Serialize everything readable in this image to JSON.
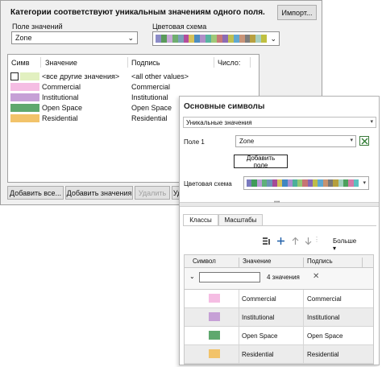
{
  "back_dialog": {
    "heading": "Категории соответствуют уникальным значениям одного поля.",
    "import_button": "Импорт...",
    "value_field": {
      "label": "Поле значений",
      "value": "Zone"
    },
    "color_scheme_label": "Цветовая схема",
    "ramp": [
      "#8c8cc8",
      "#5a9a5a",
      "#c8a8d8",
      "#6fae6f",
      "#7ba0b8",
      "#b44c9c",
      "#d6c25a",
      "#4c8cc0",
      "#b08ec8",
      "#58b4a0",
      "#a0c878",
      "#c87878",
      "#8c6cb4",
      "#c0c050",
      "#60a8d0",
      "#c89478",
      "#7c7c7c",
      "#b8a040",
      "#a8d0c0",
      "#c0c040"
    ],
    "columns": {
      "symbol": "Симв",
      "value": "Значение",
      "label": "Подпись",
      "count": "Число:"
    },
    "rows": [
      {
        "value": "<все другие значения>",
        "label": "<all other values>",
        "color": "#e2f0c0",
        "outlined": true
      },
      {
        "value": "Commercial",
        "label": "Commercial",
        "color": "#f5bde3"
      },
      {
        "value": "Institutional",
        "label": "Institutional",
        "color": "#c6a0d6"
      },
      {
        "value": "Open Space",
        "label": "Open Space",
        "color": "#5fa86e"
      },
      {
        "value": "Residential",
        "label": "Residential",
        "color": "#f2c36a"
      }
    ],
    "buttons": {
      "add_all": "Добавить все...",
      "add_values": "Добавить значения",
      "delete": "Удалить",
      "partial": "Уд"
    }
  },
  "pane": {
    "title": "Основные символы",
    "symbology_method": "Уникальные значения",
    "field1_label": "Поле 1",
    "field1_value": "Zone",
    "add_field_button": "Добавить поле",
    "color_scheme_label": "Цветовая схема",
    "ramp": [
      "#7a7abf",
      "#3f9b5a",
      "#b89bd6",
      "#5fb07a",
      "#6b93b5",
      "#a64a97",
      "#d4c05a",
      "#3f86c2",
      "#a88ed0",
      "#4bb09a",
      "#94c774",
      "#c77474",
      "#8667b5",
      "#bdbd4a",
      "#5ca8d2",
      "#c8936f",
      "#787878",
      "#b59f3d",
      "#9fd0bd",
      "#4ca05c",
      "#d47aa8",
      "#5cc0c0"
    ],
    "tabs": [
      "Классы",
      "Масштабы"
    ],
    "more_label": "Больше",
    "grid_columns": {
      "symbol": "Символ",
      "value": "Значение",
      "label": "Подпись"
    },
    "group_count": "4 значения",
    "classes": [
      {
        "value": "Commercial",
        "label": "Commercial",
        "color": "#f5bde3"
      },
      {
        "value": "Institutional",
        "label": "Institutional",
        "color": "#c6a0d6"
      },
      {
        "value": "Open Space",
        "label": "Open Space",
        "color": "#5fa86e"
      },
      {
        "value": "Residential",
        "label": "Residential",
        "color": "#f2c36a"
      }
    ]
  }
}
